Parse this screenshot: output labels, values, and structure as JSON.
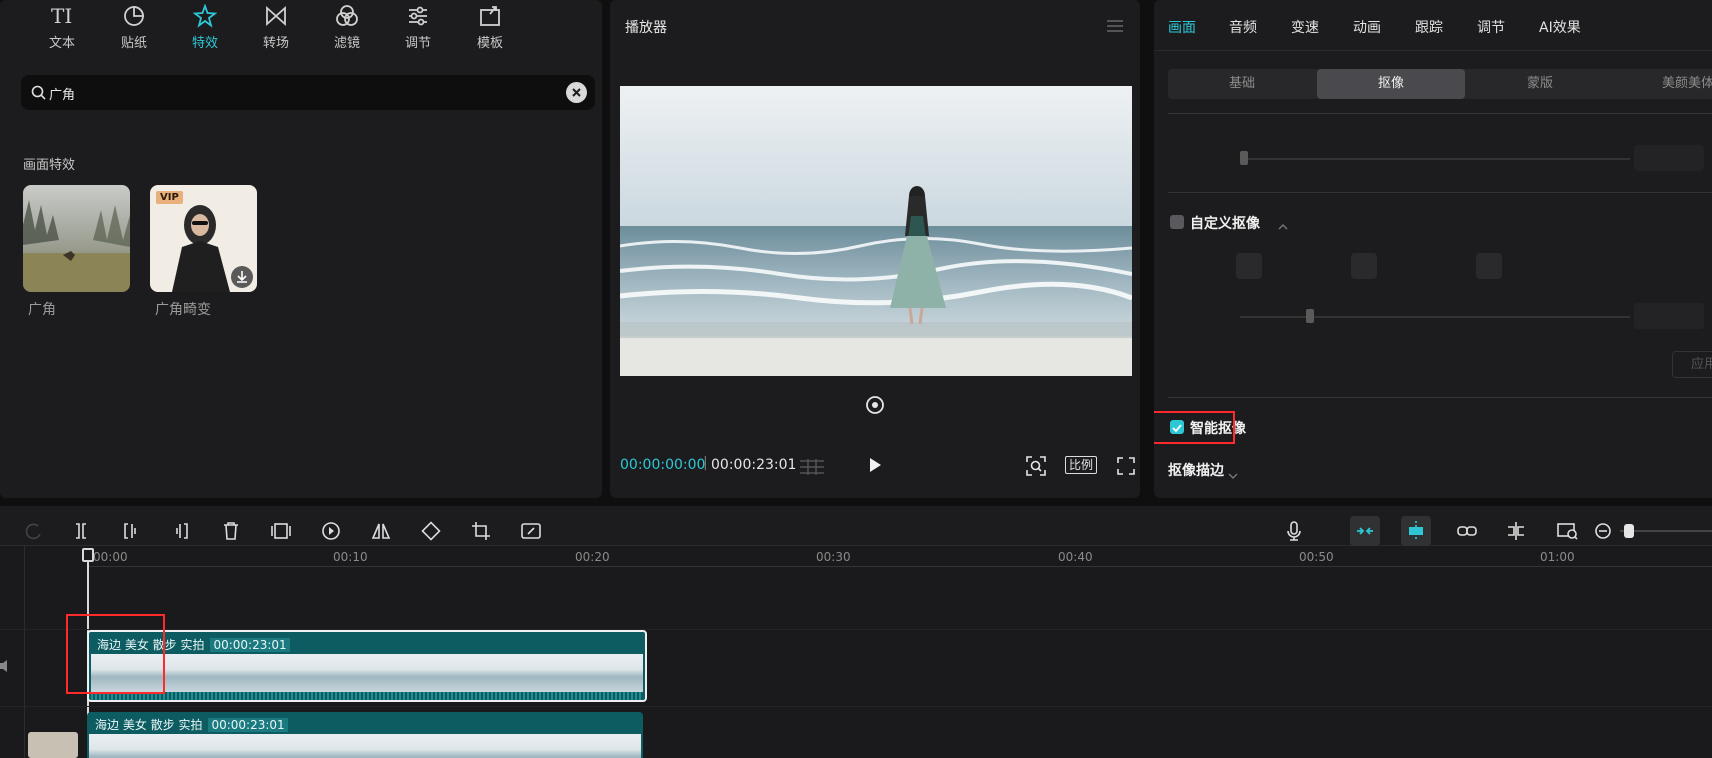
{
  "left_panel": {
    "tabs": [
      {
        "label": "文本",
        "icon": "text-icon"
      },
      {
        "label": "贴纸",
        "icon": "sticker-icon"
      },
      {
        "label": "特效",
        "icon": "effects-icon",
        "active": true
      },
      {
        "label": "转场",
        "icon": "transition-icon"
      },
      {
        "label": "滤镜",
        "icon": "filter-icon"
      },
      {
        "label": "调节",
        "icon": "adjust-icon"
      },
      {
        "label": "模板",
        "icon": "template-icon"
      }
    ],
    "search": {
      "value": "广角"
    },
    "section_title": "画面特效",
    "effects": [
      {
        "label": "广角"
      },
      {
        "label": "广角畸变",
        "badge": "VIP"
      }
    ]
  },
  "player": {
    "title": "播放器",
    "current_time": "00:00:00:00",
    "total_time": "00:00:23:01",
    "ratio_label": "比例"
  },
  "right_panel": {
    "tabs": [
      "画面",
      "音频",
      "变速",
      "动画",
      "跟踪",
      "调节",
      "AI效果"
    ],
    "active_tab": "画面",
    "subtabs": [
      "基础",
      "抠像",
      "蒙版",
      "美颜美体"
    ],
    "active_subtab": "抠像",
    "custom_keying_label": "自定义抠像",
    "smart_keying_label": "智能抠像",
    "smart_keying_checked": true,
    "keying_stroke_label": "抠像描边",
    "apply_label": "应用"
  },
  "timeline": {
    "ruler": [
      "00:00",
      "00:10",
      "00:20",
      "00:30",
      "00:40",
      "00:50",
      "01:00"
    ],
    "clips": [
      {
        "title": "海边 美女 散步 实拍",
        "duration": "00:00:23:01"
      },
      {
        "title": "海边 美女 散步 实拍",
        "duration": "00:00:23:01"
      }
    ]
  },
  "colors": {
    "accent": "#2ec7d6",
    "highlight": "#ff2a2a",
    "clip": "#0c5c62"
  }
}
